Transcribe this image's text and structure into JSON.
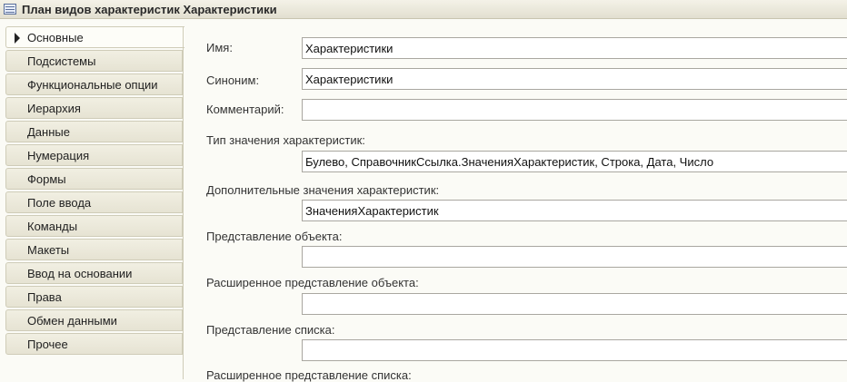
{
  "window": {
    "title": "План видов характеристик Характеристики"
  },
  "sidebar": {
    "items": [
      {
        "label": "Основные"
      },
      {
        "label": "Подсистемы"
      },
      {
        "label": "Функциональные опции"
      },
      {
        "label": "Иерархия"
      },
      {
        "label": "Данные"
      },
      {
        "label": "Нумерация"
      },
      {
        "label": "Формы"
      },
      {
        "label": "Поле ввода"
      },
      {
        "label": "Команды"
      },
      {
        "label": "Макеты"
      },
      {
        "label": "Ввод на основании"
      },
      {
        "label": "Права"
      },
      {
        "label": "Обмен данными"
      },
      {
        "label": "Прочее"
      }
    ]
  },
  "form": {
    "name_label": "Имя:",
    "name_value": "Характеристики",
    "synonym_label": "Синоним:",
    "synonym_value": "Характеристики",
    "comment_label": "Комментарий:",
    "comment_value": "",
    "value_type_label": "Тип значения характеристик:",
    "value_type_value": "Булево, СправочникСсылка.ЗначенияХарактеристик, Строка, Дата, Число",
    "additional_values_label": "Дополнительные значения характеристик:",
    "additional_values_value": "ЗначенияХарактеристик",
    "object_presentation_label": "Представление объекта:",
    "object_presentation_value": "",
    "ext_object_presentation_label": "Расширенное представление объекта:",
    "ext_object_presentation_value": "",
    "list_presentation_label": "Представление списка:",
    "list_presentation_value": "",
    "ext_list_presentation_label": "Расширенное представление списка:"
  }
}
